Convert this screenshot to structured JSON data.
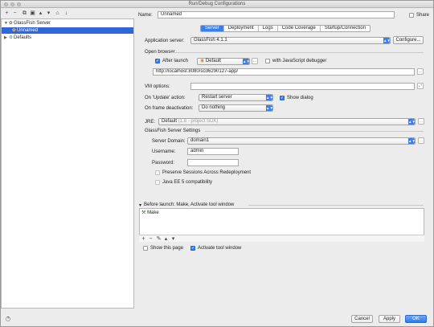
{
  "window": {
    "title": "Run/Debug Configurations"
  },
  "left_toolbar": {
    "icons": [
      "add-icon",
      "remove-icon",
      "copy-icon",
      "save-icon",
      "up-icon",
      "down-icon",
      "folder-icon",
      "sort-icon"
    ],
    "glyphs": {
      "add": "+",
      "remove": "−",
      "copy": "⧉",
      "save": "▣",
      "up": "▴",
      "down": "▾",
      "folder": "⌂",
      "sort": "↓"
    }
  },
  "tree": {
    "items": [
      {
        "label": "GlassFish Server",
        "expanded": true
      },
      {
        "label": "Unnamed",
        "selected": true
      },
      {
        "label": "Defaults",
        "expanded": false
      }
    ]
  },
  "header": {
    "name_label": "Name:",
    "name_value": "Unnamed",
    "share_label": "Share"
  },
  "tabs": [
    {
      "label": "Server",
      "active": true
    },
    {
      "label": "Deployment"
    },
    {
      "label": "Logs"
    },
    {
      "label": "Code Coverage"
    },
    {
      "label": "Startup/Connection"
    }
  ],
  "server": {
    "app_server_label": "Application server:",
    "app_server_value": "GlassFish 4.1.1",
    "configure_label": "Configure..."
  },
  "open_browser": {
    "section_label": "Open browser",
    "after_launch_label": "After launch",
    "browser_value": "Default",
    "js_debugger_label": "with JavaScript debugger",
    "url_value": "http://localhost:8080/so36290127-app/",
    "dots": "..."
  },
  "vm": {
    "label": "VM options:",
    "value": ""
  },
  "on_update": {
    "label": "On 'Update' action:",
    "value": "Restart server",
    "show_dialog_label": "Show dialog"
  },
  "on_frame": {
    "label": "On frame deactivation:",
    "value": "Do nothing"
  },
  "jre": {
    "label": "JRE:",
    "value": "Default",
    "detail": "(1.8 - project SDK)"
  },
  "glassfish_settings": {
    "section_label": "GlassFish Server Settings",
    "domain_label": "Server Domain:",
    "domain_value": "domain1",
    "username_label": "Username:",
    "username_value": "admin",
    "password_label": "Password:",
    "password_value": "",
    "preserve_label": "Preserve Sessions Across Redeployment",
    "javaee5_label": "Java EE 5 compatibility"
  },
  "before_launch": {
    "header": "Before launch: Make, Activate tool window",
    "items": [
      "Make"
    ],
    "tool_glyphs": [
      "+",
      "−",
      "✎",
      "▴",
      "▾"
    ],
    "show_page_label": "Show this page",
    "activate_label": "Activate tool window"
  },
  "footer": {
    "help": "?",
    "cancel": "Cancel",
    "apply": "Apply",
    "ok": "OK"
  },
  "colors": {
    "accent": "#3d7ee8",
    "selection": "#2f67d8"
  }
}
